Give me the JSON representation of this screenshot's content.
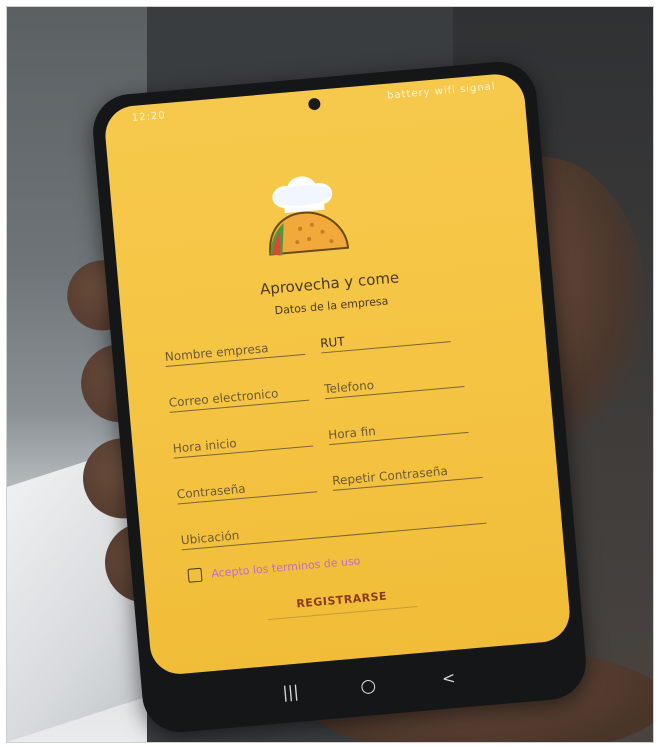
{
  "status_bar": {
    "time": "12:20",
    "icons": "battery wifi signal"
  },
  "app": {
    "title": "Aprovecha y come",
    "subtitle": "Datos de la empresa",
    "logo_icon": "taco-chef-icon"
  },
  "form": {
    "company_name_placeholder": "Nombre empresa",
    "rut_value": "RUT",
    "email_placeholder": "Correo electronico",
    "phone_placeholder": "Telefono",
    "start_time_placeholder": "Hora inicio",
    "end_time_placeholder": "Hora fin",
    "password_placeholder": "Contraseña",
    "repeat_password_placeholder": "Repetir Contraseña",
    "location_placeholder": "Ubicación",
    "agree_label": "Acepto los terminos de uso",
    "register_button": "REGISTRARSE"
  },
  "colors": {
    "screen_yellow": "#f5c443",
    "accent_purple": "#c06ec0",
    "button_text": "#8a3b1a"
  },
  "nav": {
    "recents": "|||",
    "home": "○",
    "back": "<"
  }
}
